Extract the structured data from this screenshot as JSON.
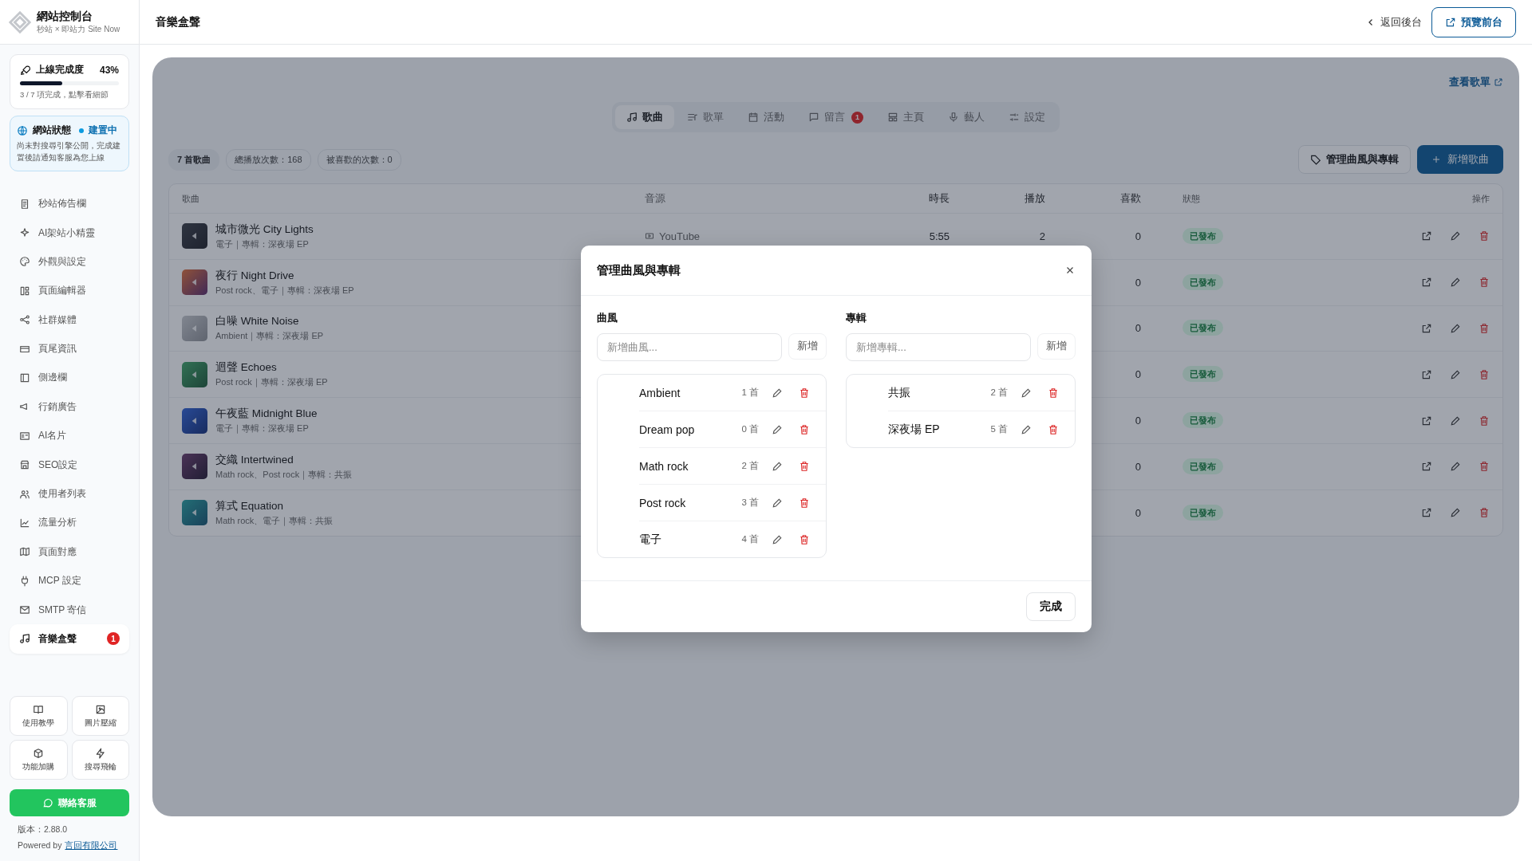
{
  "brand": {
    "title": "網站控制台",
    "subtitle": "秒站 × 即站力 Site Now"
  },
  "progress_card": {
    "label": "上線完成度",
    "percent": "43%",
    "level": 0.43,
    "caption": "3 / 7 項完成，點擊看細節"
  },
  "status_card": {
    "label": "網站狀態",
    "status": "建置中",
    "description": "尚未對搜尋引擎公開，完成建置後請通知客服為您上線"
  },
  "sidebar": {
    "items": [
      {
        "label": "秒站佈告欄",
        "selected": false
      },
      {
        "label": "AI架站小精靈",
        "selected": false
      },
      {
        "label": "外觀與設定",
        "selected": false
      },
      {
        "label": "頁面編輯器",
        "selected": false
      },
      {
        "label": "社群媒體",
        "selected": false
      },
      {
        "label": "頁尾資訊",
        "selected": false
      },
      {
        "label": "側邊欄",
        "selected": false
      },
      {
        "label": "行銷廣告",
        "selected": false
      },
      {
        "label": "AI名片",
        "selected": false
      },
      {
        "label": "SEO設定",
        "selected": false
      },
      {
        "label": "使用者列表",
        "selected": false
      },
      {
        "label": "流量分析",
        "selected": false
      },
      {
        "label": "頁面對應",
        "selected": false
      },
      {
        "label": "MCP 設定",
        "selected": false
      },
      {
        "label": "SMTP 寄信",
        "selected": false
      },
      {
        "label": "音樂盒聲",
        "selected": true,
        "badge": "1"
      }
    ]
  },
  "shortcuts": [
    {
      "label": "使用教學"
    },
    {
      "label": "圖片壓縮"
    },
    {
      "label": "功能加購"
    },
    {
      "label": "搜尋飛輪"
    }
  ],
  "contact_button": "聯絡客服",
  "version": "版本：2.88.0",
  "powered_by": {
    "text": "Powered by",
    "link": "言回有限公司"
  },
  "header": {
    "title": "音樂盒聲",
    "back": "返回後台",
    "preview": "預覽前台"
  },
  "view_playlist_link": "查看歌單",
  "tabs": [
    {
      "label": "歌曲",
      "selected": true
    },
    {
      "label": "歌單",
      "selected": false
    },
    {
      "label": "活動",
      "selected": false
    },
    {
      "label": "留言",
      "selected": false,
      "badge": "1"
    },
    {
      "label": "主頁",
      "selected": false
    },
    {
      "label": "藝人",
      "selected": false
    },
    {
      "label": "設定",
      "selected": false
    }
  ],
  "stats": [
    "7 首歌曲",
    "總播放次數：168",
    "被喜歡的次數：0"
  ],
  "manage_button": "管理曲風與專輯",
  "add_button": "新增歌曲",
  "table": {
    "columns": [
      "歌曲",
      "音源",
      "時長",
      "播放",
      "喜歡",
      "狀態",
      "操作"
    ],
    "rows": [
      {
        "title": "城市微光 City Lights",
        "meta": "電子｜專輯：深夜場 EP",
        "source": "YouTube",
        "duration": "5:55",
        "plays": "2",
        "likes": "0",
        "status": "已發布"
      },
      {
        "title": "夜行 Night Drive",
        "meta": "Post rock、電子｜專輯：深夜場 EP",
        "likes": "0",
        "status": "已發布"
      },
      {
        "title": "白噪 White Noise",
        "meta": "Ambient｜專輯：深夜場 EP",
        "likes": "0",
        "status": "已發布"
      },
      {
        "title": "迴聲 Echoes",
        "meta": "Post rock｜專輯：深夜場 EP",
        "likes": "0",
        "status": "已發布"
      },
      {
        "title": "午夜藍 Midnight Blue",
        "meta": "電子｜專輯：深夜場 EP",
        "likes": "0",
        "status": "已發布"
      },
      {
        "title": "交織 Intertwined",
        "meta": "Math rock、Post rock｜專輯：共振",
        "likes": "0",
        "status": "已發布"
      },
      {
        "title": "算式 Equation",
        "meta": "Math rock、電子｜專輯：共振",
        "likes": "0",
        "status": "已發布"
      }
    ]
  },
  "modal": {
    "title": "管理曲風與專輯",
    "done": "完成",
    "sections": [
      {
        "heading": "曲風",
        "placeholder": "新增曲風...",
        "add": "新增",
        "items": [
          {
            "name": "Ambient",
            "count": "1 首"
          },
          {
            "name": "Dream pop",
            "count": "0 首"
          },
          {
            "name": "Math rock",
            "count": "2 首"
          },
          {
            "name": "Post rock",
            "count": "3 首"
          },
          {
            "name": "電子",
            "count": "4 首"
          }
        ]
      },
      {
        "heading": "專輯",
        "placeholder": "新增專輯...",
        "add": "新增",
        "items": [
          {
            "name": "共振",
            "count": "2 首"
          },
          {
            "name": "深夜場 EP",
            "count": "5 首"
          }
        ]
      }
    ]
  }
}
